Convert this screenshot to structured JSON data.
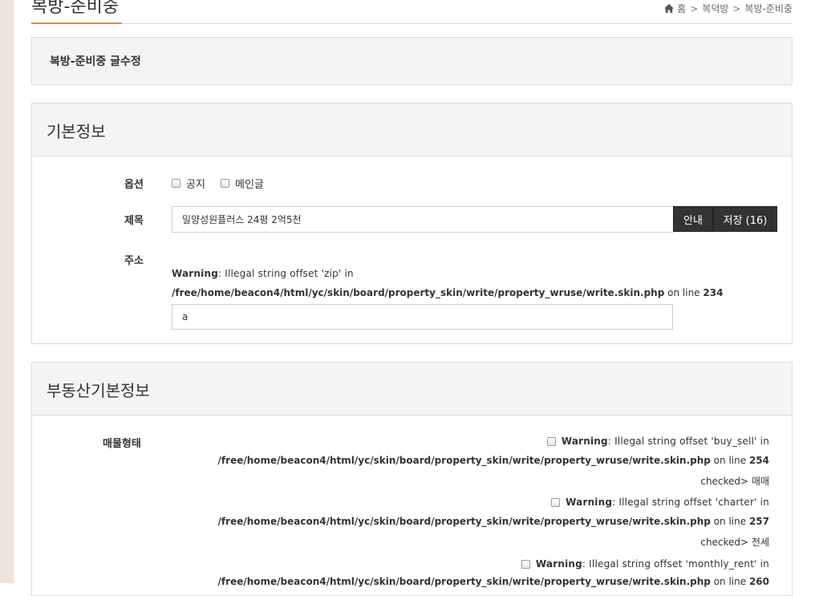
{
  "header": {
    "title": "복방-준비중",
    "breadcrumb": [
      "홈",
      "복덕방",
      "복방-준비중"
    ]
  },
  "edit_title": "복방-준비중 글수정",
  "basic": {
    "heading": "기본정보",
    "options_label": "옵션",
    "option_notice": "공지",
    "option_main": "메인글",
    "subject_label": "제목",
    "subject_value": "밀양성원플러스 24평 2억5천",
    "guide_button": "안내",
    "save_button": "저장 (16)",
    "address_label": "주소",
    "warn_prefix": "Warning",
    "warn_zip": ": Illegal string offset 'zip' in",
    "path_file": "/free/home/beacon4/html/yc/skin/board/property_skin/write/property_wruse/write.skin.php",
    "on_line": "on line",
    "line_zip": "234",
    "address_value": "a"
  },
  "realestate": {
    "heading": "부동산기본정보",
    "type_label": "매물형태",
    "warn_buy_sell": ": Illegal string offset 'buy_sell' in",
    "line_buy_sell": "254",
    "checked_buy_sell": "checked> 매매",
    "warn_charter": ": Illegal string offset 'charter' in",
    "line_charter": "257",
    "checked_charter": "checked> 전세",
    "warn_monthly": ": Illegal string offset 'monthly_rent' in",
    "line_monthly": "260"
  },
  "colors": {
    "accent": "#f08a24",
    "dark_button": "#333333",
    "panel_head": "#f4f4f4"
  }
}
